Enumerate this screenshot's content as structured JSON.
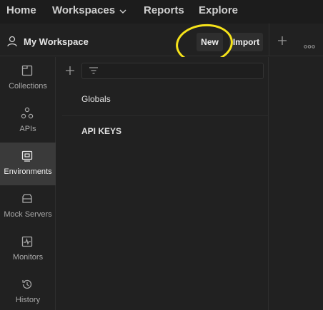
{
  "topnav": {
    "home": "Home",
    "workspaces": "Workspaces",
    "reports": "Reports",
    "explore": "Explore"
  },
  "workspace": {
    "title": "My Workspace",
    "new_label": "New",
    "import_label": "Import"
  },
  "sidebar": {
    "items": [
      {
        "label": "Collections",
        "icon": "collections-icon"
      },
      {
        "label": "APIs",
        "icon": "apis-icon"
      },
      {
        "label": "Environments",
        "icon": "environments-icon",
        "active": true
      },
      {
        "label": "Mock Servers",
        "icon": "mock-servers-icon"
      },
      {
        "label": "Monitors",
        "icon": "monitors-icon"
      },
      {
        "label": "History",
        "icon": "history-icon"
      }
    ]
  },
  "environments": {
    "items": [
      "Globals",
      "API KEYS"
    ]
  },
  "colors": {
    "background": "#212121",
    "active_item": "#3a3a3a",
    "highlight": "#f6e31a"
  }
}
